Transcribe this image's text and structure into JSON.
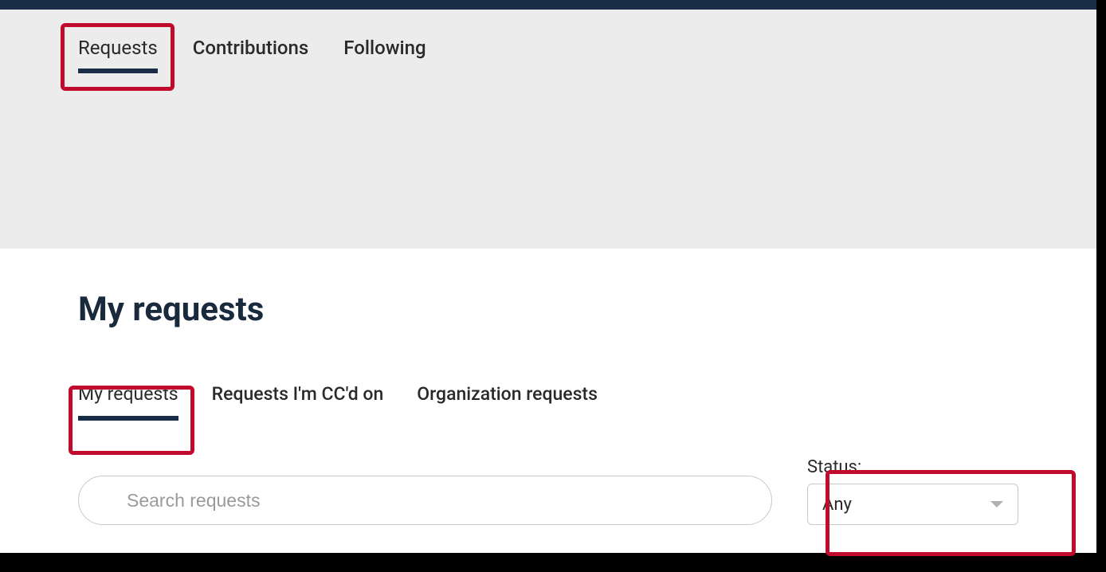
{
  "top_tabs": {
    "requests": "Requests",
    "contributions": "Contributions",
    "following": "Following"
  },
  "main": {
    "title": "My requests",
    "sub_tabs": {
      "my_requests": "My requests",
      "cc": "Requests I'm CC'd on",
      "org": "Organization requests"
    },
    "search": {
      "placeholder": "Search requests"
    },
    "status": {
      "label": "Status:",
      "value": "Any"
    }
  }
}
